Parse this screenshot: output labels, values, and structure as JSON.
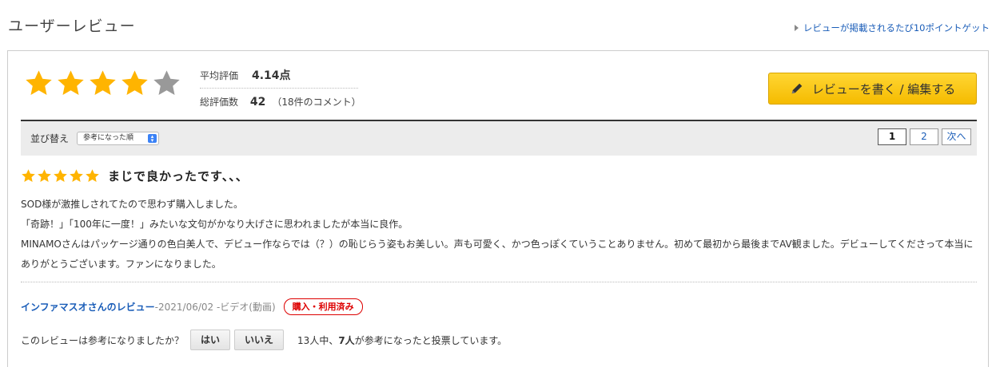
{
  "header": {
    "title": "ユーザーレビュー",
    "points_link": "レビューが掲載されるたび10ポイントゲット"
  },
  "summary": {
    "average_label": "平均評価",
    "average_value": "4.14点",
    "total_label": "総評価数",
    "total_value": "42",
    "comment_note": "（18件のコメント）",
    "star_rating": 4.14
  },
  "write_button": {
    "label": "レビューを書く / 編集する",
    "icon": "pencil-icon"
  },
  "sortbar": {
    "sort_label": "並び替え",
    "sort_selected": "参考になった順",
    "pages": [
      "1",
      "2"
    ],
    "current_page": "1",
    "next_label": "次へ"
  },
  "review": {
    "rating": 5,
    "title": "まじで良かったです、、、",
    "body_lines": [
      "SOD様が激推しされてたので思わず購入しました。",
      "「奇跡！」「100年に一度！」みたいな文句がかなり大げさに思われましたが本当に良作。",
      "MINAMOさんはパッケージ通りの色白美人で、デビュー作ならでは（？）の恥じらう姿もお美しい。声も可愛く、かつ色っぽくていうことありません。初めて最初から最後までAV観ました。デビューしてくださって本当にありがとうございます。ファンになりました。"
    ],
    "reviewer": "インファマスオさんのレビュー",
    "date_meta": " -2021/06/02 -ビデオ(動画)",
    "badge": "購入・利用済み",
    "helpful_question": "このレビューは参考になりましたか？",
    "yes_label": "はい",
    "no_label": "いいえ",
    "helpful_prefix": "13人中、",
    "helpful_count": "7人",
    "helpful_suffix": "が参考になったと投票しています。"
  },
  "colors": {
    "star_filled": "#ffb400",
    "star_empty": "#999999",
    "link": "#1a5db8",
    "badge": "#dd0000",
    "button_yellow": "#f5bb00"
  }
}
